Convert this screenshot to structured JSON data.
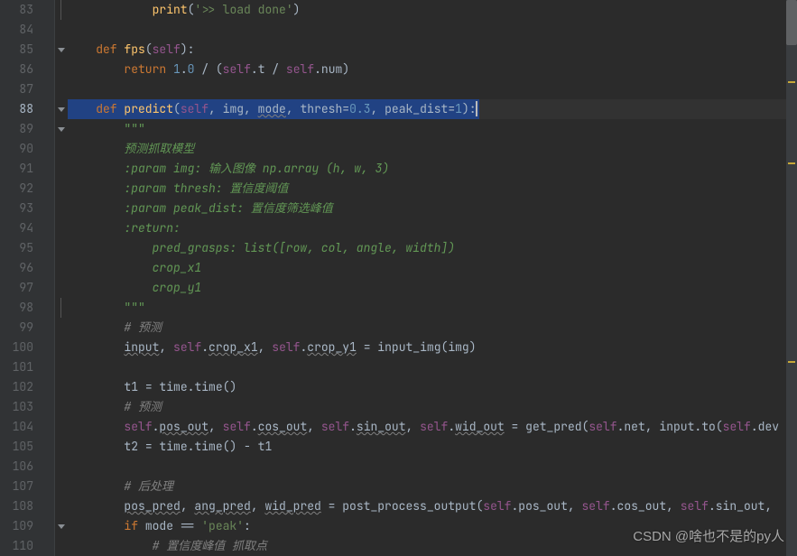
{
  "gutter_start": 83,
  "gutter_end": 110,
  "watermark": "CSDN @啥也不是的py人",
  "lines": {
    "l83": {
      "i": "            ",
      "t": [
        [
          "fn",
          "print"
        ],
        [
          "p",
          "("
        ],
        [
          "str",
          "'>> load done'"
        ],
        [
          "p",
          ")"
        ]
      ]
    },
    "l84": {
      "i": "",
      "t": []
    },
    "l85": {
      "i": "    ",
      "t": [
        [
          "kw",
          "def "
        ],
        [
          "fn",
          "fps"
        ],
        [
          "p",
          "("
        ],
        [
          "self",
          "self"
        ],
        [
          "p",
          ")"
        ],
        [
          "op",
          ":"
        ]
      ]
    },
    "l86": {
      "i": "        ",
      "t": [
        [
          "kw",
          "return "
        ],
        [
          "num",
          "1"
        ],
        [
          "op",
          "."
        ],
        [
          "num",
          "0"
        ],
        [
          "op",
          " / "
        ],
        [
          "p",
          "("
        ],
        [
          "self",
          "self"
        ],
        [
          "op",
          "."
        ],
        [
          "p",
          "t"
        ],
        [
          "op",
          " / "
        ],
        [
          "self",
          "self"
        ],
        [
          "op",
          "."
        ],
        [
          "p",
          "num"
        ],
        [
          "p",
          ")"
        ]
      ]
    },
    "l87": {
      "i": "",
      "t": []
    },
    "l88": {
      "i": "    ",
      "hl": true,
      "t": [
        [
          "kw",
          "def "
        ],
        [
          "fn",
          "predict"
        ],
        [
          "p",
          "("
        ],
        [
          "self",
          "self"
        ],
        [
          "op",
          ", "
        ],
        [
          "p",
          "img"
        ],
        [
          "op",
          ", "
        ],
        [
          "warn",
          "mode"
        ],
        [
          "op",
          ", "
        ],
        [
          "p",
          "thresh"
        ],
        [
          "op",
          "="
        ],
        [
          "num",
          "0.3"
        ],
        [
          "op",
          ", "
        ],
        [
          "p",
          "peak_dist"
        ],
        [
          "op",
          "="
        ],
        [
          "num",
          "1"
        ],
        [
          "p",
          ")"
        ],
        [
          "op",
          ":"
        ]
      ]
    },
    "l89": {
      "i": "        ",
      "t": [
        [
          "docq",
          "\"\"\""
        ]
      ]
    },
    "l90": {
      "i": "        ",
      "t": [
        [
          "doc",
          "预测抓取模型"
        ]
      ]
    },
    "l91": {
      "i": "        ",
      "t": [
        [
          "doc",
          ":param img: 输入图像 np.array (h, w, 3)"
        ]
      ]
    },
    "l92": {
      "i": "        ",
      "t": [
        [
          "doc",
          ":param thresh: 置信度阈值"
        ]
      ]
    },
    "l93": {
      "i": "        ",
      "t": [
        [
          "doc",
          ":param peak_dist: 置信度筛选峰值"
        ]
      ]
    },
    "l94": {
      "i": "        ",
      "t": [
        [
          "doc",
          ":return:"
        ]
      ]
    },
    "l95": {
      "i": "            ",
      "t": [
        [
          "doc",
          "pred_grasps: list([row, col, angle, width])"
        ]
      ]
    },
    "l96": {
      "i": "            ",
      "t": [
        [
          "doc",
          "crop_x1"
        ]
      ]
    },
    "l97": {
      "i": "            ",
      "t": [
        [
          "doc",
          "crop_y1"
        ]
      ]
    },
    "l98": {
      "i": "        ",
      "t": [
        [
          "docq",
          "\"\"\""
        ]
      ]
    },
    "l99": {
      "i": "        ",
      "t": [
        [
          "cm",
          "# 预测"
        ]
      ]
    },
    "l100": {
      "i": "        ",
      "t": [
        [
          "warn",
          "input"
        ],
        [
          "op",
          ", "
        ],
        [
          "self",
          "self"
        ],
        [
          "op",
          "."
        ],
        [
          "warn",
          "crop_x1"
        ],
        [
          "op",
          ", "
        ],
        [
          "self",
          "self"
        ],
        [
          "op",
          "."
        ],
        [
          "warn",
          "crop_y1"
        ],
        [
          "op",
          " = "
        ],
        [
          "p",
          "input_img"
        ],
        [
          "p",
          "("
        ],
        [
          "p",
          "img"
        ],
        [
          "p",
          ")"
        ]
      ]
    },
    "l101": {
      "i": "",
      "t": []
    },
    "l102": {
      "i": "        ",
      "t": [
        [
          "p",
          "t1"
        ],
        [
          "op",
          " = "
        ],
        [
          "p",
          "time"
        ],
        [
          "op",
          "."
        ],
        [
          "p",
          "time"
        ],
        [
          "p",
          "()"
        ]
      ]
    },
    "l103": {
      "i": "        ",
      "t": [
        [
          "cm",
          "# 预测"
        ]
      ]
    },
    "l104": {
      "i": "        ",
      "t": [
        [
          "self",
          "self"
        ],
        [
          "op",
          "."
        ],
        [
          "warn",
          "pos_out"
        ],
        [
          "op",
          ", "
        ],
        [
          "self",
          "self"
        ],
        [
          "op",
          "."
        ],
        [
          "warn",
          "cos_out"
        ],
        [
          "op",
          ", "
        ],
        [
          "self",
          "self"
        ],
        [
          "op",
          "."
        ],
        [
          "warn",
          "sin_out"
        ],
        [
          "op",
          ", "
        ],
        [
          "self",
          "self"
        ],
        [
          "op",
          "."
        ],
        [
          "warn",
          "wid_out"
        ],
        [
          "op",
          " = "
        ],
        [
          "p",
          "get_pred"
        ],
        [
          "p",
          "("
        ],
        [
          "self",
          "self"
        ],
        [
          "op",
          "."
        ],
        [
          "p",
          "net"
        ],
        [
          "op",
          ", "
        ],
        [
          "p",
          "input"
        ],
        [
          "op",
          "."
        ],
        [
          "p",
          "to"
        ],
        [
          "p",
          "("
        ],
        [
          "self",
          "self"
        ],
        [
          "op",
          "."
        ],
        [
          "p",
          "dev"
        ]
      ]
    },
    "l105": {
      "i": "        ",
      "t": [
        [
          "p",
          "t2"
        ],
        [
          "op",
          " = "
        ],
        [
          "p",
          "time"
        ],
        [
          "op",
          "."
        ],
        [
          "p",
          "time"
        ],
        [
          "p",
          "()"
        ],
        [
          "op",
          " - "
        ],
        [
          "p",
          "t1"
        ]
      ]
    },
    "l106": {
      "i": "",
      "t": []
    },
    "l107": {
      "i": "        ",
      "t": [
        [
          "cm",
          "# 后处理"
        ]
      ]
    },
    "l108": {
      "i": "        ",
      "t": [
        [
          "warn",
          "pos_pred"
        ],
        [
          "op",
          ", "
        ],
        [
          "warn",
          "ang_pred"
        ],
        [
          "op",
          ", "
        ],
        [
          "warn",
          "wid_pred"
        ],
        [
          "op",
          " = "
        ],
        [
          "p",
          "post_process_output"
        ],
        [
          "p",
          "("
        ],
        [
          "self",
          "self"
        ],
        [
          "op",
          "."
        ],
        [
          "p",
          "pos_out"
        ],
        [
          "op",
          ", "
        ],
        [
          "self",
          "self"
        ],
        [
          "op",
          "."
        ],
        [
          "p",
          "cos_out"
        ],
        [
          "op",
          ", "
        ],
        [
          "self",
          "self"
        ],
        [
          "op",
          "."
        ],
        [
          "p",
          "sin_out"
        ],
        [
          "op",
          ","
        ]
      ]
    },
    "l109": {
      "i": "        ",
      "t": [
        [
          "kw",
          "if "
        ],
        [
          "p",
          "mode"
        ],
        [
          "op",
          " == "
        ],
        [
          "str",
          "'peak'"
        ],
        [
          "op",
          ":"
        ]
      ]
    },
    "l110": {
      "i": "            ",
      "t": [
        [
          "cm",
          "# 置信度峰值 抓取点"
        ]
      ]
    }
  },
  "fold_marks": {
    "83": "l",
    "85": "d",
    "88": "d",
    "89": "d",
    "98": "l",
    "109": "d"
  }
}
